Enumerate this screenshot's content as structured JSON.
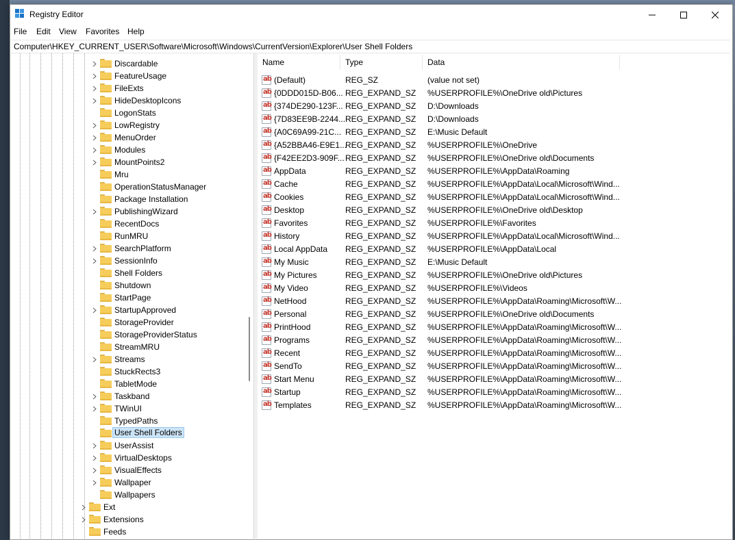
{
  "window": {
    "title": "Registry Editor"
  },
  "menu": [
    "File",
    "Edit",
    "View",
    "Favorites",
    "Help"
  ],
  "address": "Computer\\HKEY_CURRENT_USER\\Software\\Microsoft\\Windows\\CurrentVersion\\Explorer\\User Shell Folders",
  "tree": {
    "explorer_children": [
      {
        "label": "Discardable",
        "expandable": true
      },
      {
        "label": "FeatureUsage",
        "expandable": true
      },
      {
        "label": "FileExts",
        "expandable": true
      },
      {
        "label": "HideDesktopIcons",
        "expandable": true
      },
      {
        "label": "LogonStats",
        "expandable": false
      },
      {
        "label": "LowRegistry",
        "expandable": true
      },
      {
        "label": "MenuOrder",
        "expandable": true
      },
      {
        "label": "Modules",
        "expandable": true
      },
      {
        "label": "MountPoints2",
        "expandable": true
      },
      {
        "label": "Mru",
        "expandable": false
      },
      {
        "label": "OperationStatusManager",
        "expandable": false
      },
      {
        "label": "Package Installation",
        "expandable": false
      },
      {
        "label": "PublishingWizard",
        "expandable": true
      },
      {
        "label": "RecentDocs",
        "expandable": false
      },
      {
        "label": "RunMRU",
        "expandable": false
      },
      {
        "label": "SearchPlatform",
        "expandable": true
      },
      {
        "label": "SessionInfo",
        "expandable": true
      },
      {
        "label": "Shell Folders",
        "expandable": false
      },
      {
        "label": "Shutdown",
        "expandable": false
      },
      {
        "label": "StartPage",
        "expandable": false
      },
      {
        "label": "StartupApproved",
        "expandable": true
      },
      {
        "label": "StorageProvider",
        "expandable": false
      },
      {
        "label": "StorageProviderStatus",
        "expandable": false
      },
      {
        "label": "StreamMRU",
        "expandable": false
      },
      {
        "label": "Streams",
        "expandable": true
      },
      {
        "label": "StuckRects3",
        "expandable": false
      },
      {
        "label": "TabletMode",
        "expandable": false
      },
      {
        "label": "Taskband",
        "expandable": true
      },
      {
        "label": "TWinUI",
        "expandable": true
      },
      {
        "label": "TypedPaths",
        "expandable": false
      },
      {
        "label": "User Shell Folders",
        "expandable": false,
        "selected": true
      },
      {
        "label": "UserAssist",
        "expandable": true
      },
      {
        "label": "VirtualDesktops",
        "expandable": true
      },
      {
        "label": "VisualEffects",
        "expandable": true
      },
      {
        "label": "Wallpaper",
        "expandable": true
      },
      {
        "label": "Wallpapers",
        "expandable": false
      }
    ],
    "sibling_children": [
      {
        "label": "Ext",
        "expandable": true
      },
      {
        "label": "Extensions",
        "expandable": true
      },
      {
        "label": "Feeds",
        "expandable": false
      }
    ]
  },
  "list": {
    "columns": [
      "Name",
      "Type",
      "Data"
    ],
    "rows": [
      {
        "name": "(Default)",
        "type": "REG_SZ",
        "data": "(value not set)"
      },
      {
        "name": "{0DDD015D-B06...",
        "type": "REG_EXPAND_SZ",
        "data": "%USERPROFILE%\\OneDrive old\\Pictures"
      },
      {
        "name": "{374DE290-123F...",
        "type": "REG_EXPAND_SZ",
        "data": "D:\\Downloads"
      },
      {
        "name": "{7D83EE9B-2244...",
        "type": "REG_EXPAND_SZ",
        "data": "D:\\Downloads"
      },
      {
        "name": "{A0C69A99-21C...",
        "type": "REG_EXPAND_SZ",
        "data": "E:\\Music Default"
      },
      {
        "name": "{A52BBA46-E9E1...",
        "type": "REG_EXPAND_SZ",
        "data": "%USERPROFILE%\\OneDrive"
      },
      {
        "name": "{F42EE2D3-909F...",
        "type": "REG_EXPAND_SZ",
        "data": "%USERPROFILE%\\OneDrive old\\Documents"
      },
      {
        "name": "AppData",
        "type": "REG_EXPAND_SZ",
        "data": "%USERPROFILE%\\AppData\\Roaming"
      },
      {
        "name": "Cache",
        "type": "REG_EXPAND_SZ",
        "data": "%USERPROFILE%\\AppData\\Local\\Microsoft\\Wind..."
      },
      {
        "name": "Cookies",
        "type": "REG_EXPAND_SZ",
        "data": "%USERPROFILE%\\AppData\\Local\\Microsoft\\Wind..."
      },
      {
        "name": "Desktop",
        "type": "REG_EXPAND_SZ",
        "data": "%USERPROFILE%\\OneDrive old\\Desktop"
      },
      {
        "name": "Favorites",
        "type": "REG_EXPAND_SZ",
        "data": "%USERPROFILE%\\Favorites"
      },
      {
        "name": "History",
        "type": "REG_EXPAND_SZ",
        "data": "%USERPROFILE%\\AppData\\Local\\Microsoft\\Wind..."
      },
      {
        "name": "Local AppData",
        "type": "REG_EXPAND_SZ",
        "data": "%USERPROFILE%\\AppData\\Local"
      },
      {
        "name": "My Music",
        "type": "REG_EXPAND_SZ",
        "data": "E:\\Music Default"
      },
      {
        "name": "My Pictures",
        "type": "REG_EXPAND_SZ",
        "data": "%USERPROFILE%\\OneDrive old\\Pictures"
      },
      {
        "name": "My Video",
        "type": "REG_EXPAND_SZ",
        "data": "%USERPROFILE%\\Videos"
      },
      {
        "name": "NetHood",
        "type": "REG_EXPAND_SZ",
        "data": "%USERPROFILE%\\AppData\\Roaming\\Microsoft\\W..."
      },
      {
        "name": "Personal",
        "type": "REG_EXPAND_SZ",
        "data": "%USERPROFILE%\\OneDrive old\\Documents"
      },
      {
        "name": "PrintHood",
        "type": "REG_EXPAND_SZ",
        "data": "%USERPROFILE%\\AppData\\Roaming\\Microsoft\\W..."
      },
      {
        "name": "Programs",
        "type": "REG_EXPAND_SZ",
        "data": "%USERPROFILE%\\AppData\\Roaming\\Microsoft\\W..."
      },
      {
        "name": "Recent",
        "type": "REG_EXPAND_SZ",
        "data": "%USERPROFILE%\\AppData\\Roaming\\Microsoft\\W..."
      },
      {
        "name": "SendTo",
        "type": "REG_EXPAND_SZ",
        "data": "%USERPROFILE%\\AppData\\Roaming\\Microsoft\\W..."
      },
      {
        "name": "Start Menu",
        "type": "REG_EXPAND_SZ",
        "data": "%USERPROFILE%\\AppData\\Roaming\\Microsoft\\W..."
      },
      {
        "name": "Startup",
        "type": "REG_EXPAND_SZ",
        "data": "%USERPROFILE%\\AppData\\Roaming\\Microsoft\\W..."
      },
      {
        "name": "Templates",
        "type": "REG_EXPAND_SZ",
        "data": "%USERPROFILE%\\AppData\\Roaming\\Microsoft\\W..."
      }
    ]
  },
  "icons": {
    "app": "registry-editor-icon",
    "minimize": "minimize-icon",
    "maximize": "maximize-icon",
    "close": "close-icon",
    "folder": "folder-icon",
    "value": "string-value-icon",
    "expand": "chevron-right-icon"
  },
  "colors": {
    "folder": "#f6cd5b",
    "selection": "#cce4f7",
    "value_icon_text": "#c4392f"
  }
}
